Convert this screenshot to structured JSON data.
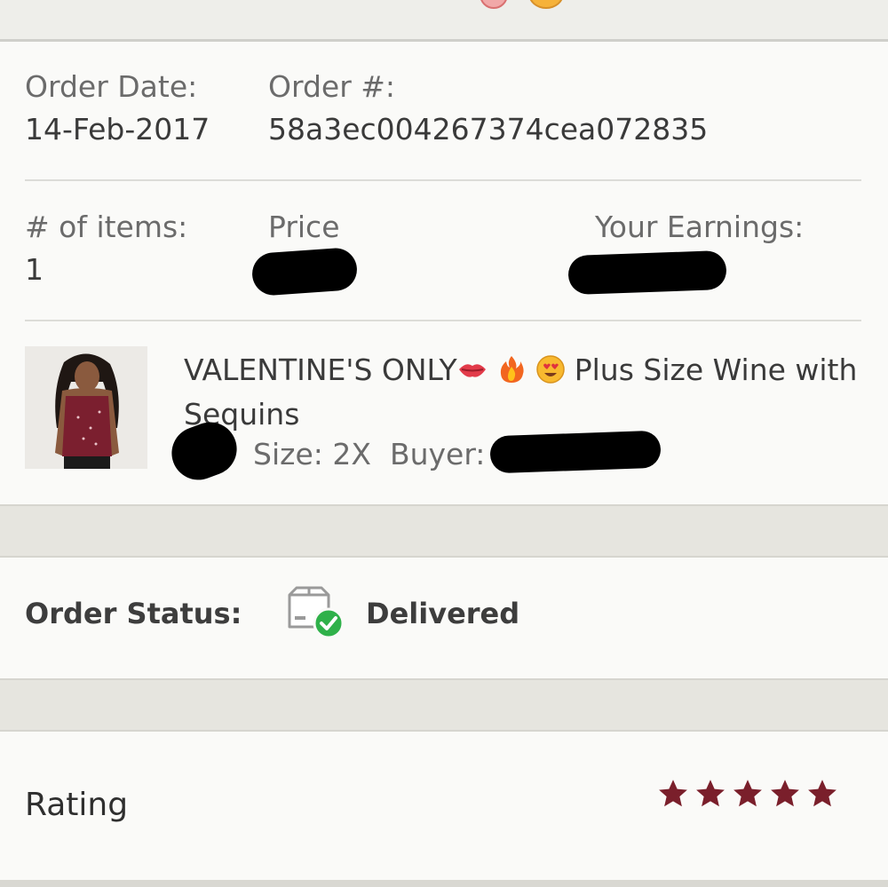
{
  "order": {
    "date_label": "Order Date:",
    "date_value": "14-Feb-2017",
    "number_label": "Order #:",
    "number_value": "58a3ec004267374cea072835",
    "items_label": "# of items:",
    "items_value": "1",
    "price_label": "Price",
    "earnings_label": "Your Earnings:"
  },
  "item": {
    "title_prefix": "VALENTINE'S ONLY",
    "title_suffix": "Plus Size Wine with Sequins",
    "emoji_icons": [
      "kiss-icon",
      "fire-icon",
      "heart-eyes-icon"
    ],
    "size_text": "Size: 2X",
    "buyer_label": "Buyer:"
  },
  "status": {
    "label": "Order Status:",
    "value": "Delivered",
    "icon": "delivered-box-icon",
    "check_color": "#2fb14a"
  },
  "rating": {
    "label": "Rating",
    "stars": 5,
    "star_color": "#7a1f2b"
  }
}
